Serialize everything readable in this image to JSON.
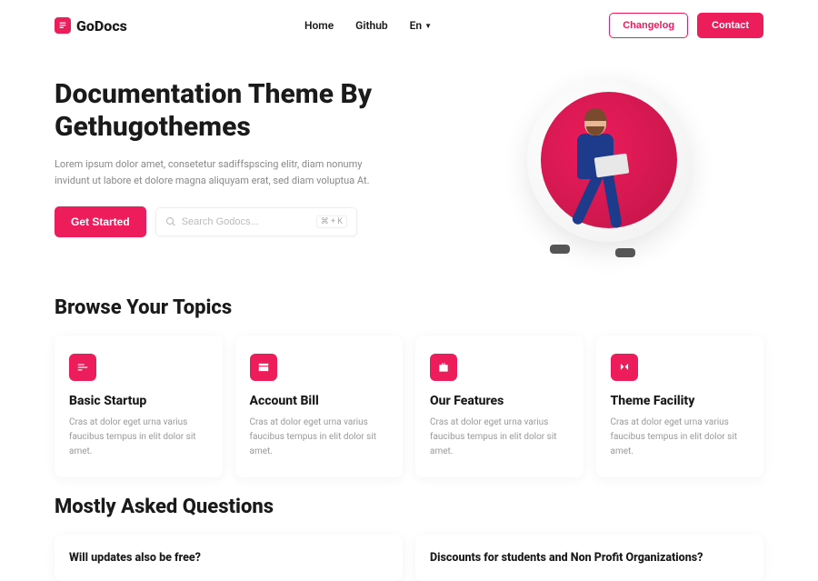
{
  "brand": {
    "name": "GoDocs"
  },
  "nav": {
    "links": [
      {
        "label": "Home"
      },
      {
        "label": "Github"
      }
    ],
    "lang": "En",
    "changelog": "Changelog",
    "contact": "Contact"
  },
  "hero": {
    "title": "Documentation Theme By Gethugothemes",
    "subtitle": "Lorem ipsum dolor amet, consetetur sadiffspscing elitr, diam nonumy invidunt ut labore et dolore magna aliquyam erat, sed diam voluptua At.",
    "cta": "Get Started",
    "search_placeholder": "Search Godocs...",
    "kbd": "⌘ + K"
  },
  "topics": {
    "heading": "Browse Your Topics",
    "cards": [
      {
        "title": "Basic Startup",
        "desc": "Cras at dolor eget urna varius faucibus tempus in elit dolor sit amet."
      },
      {
        "title": "Account Bill",
        "desc": "Cras at dolor eget urna varius faucibus tempus in elit dolor sit amet."
      },
      {
        "title": "Our Features",
        "desc": "Cras at dolor eget urna varius faucibus tempus in elit dolor sit amet."
      },
      {
        "title": "Theme Facility",
        "desc": "Cras at dolor eget urna varius faucibus tempus in elit dolor sit amet."
      }
    ]
  },
  "faq": {
    "heading": "Mostly Asked Questions",
    "items": [
      {
        "q": "Will updates also be free?"
      },
      {
        "q": "Discounts for students and Non Profit Organizations?"
      }
    ]
  },
  "colors": {
    "accent": "#ed1c5b"
  }
}
